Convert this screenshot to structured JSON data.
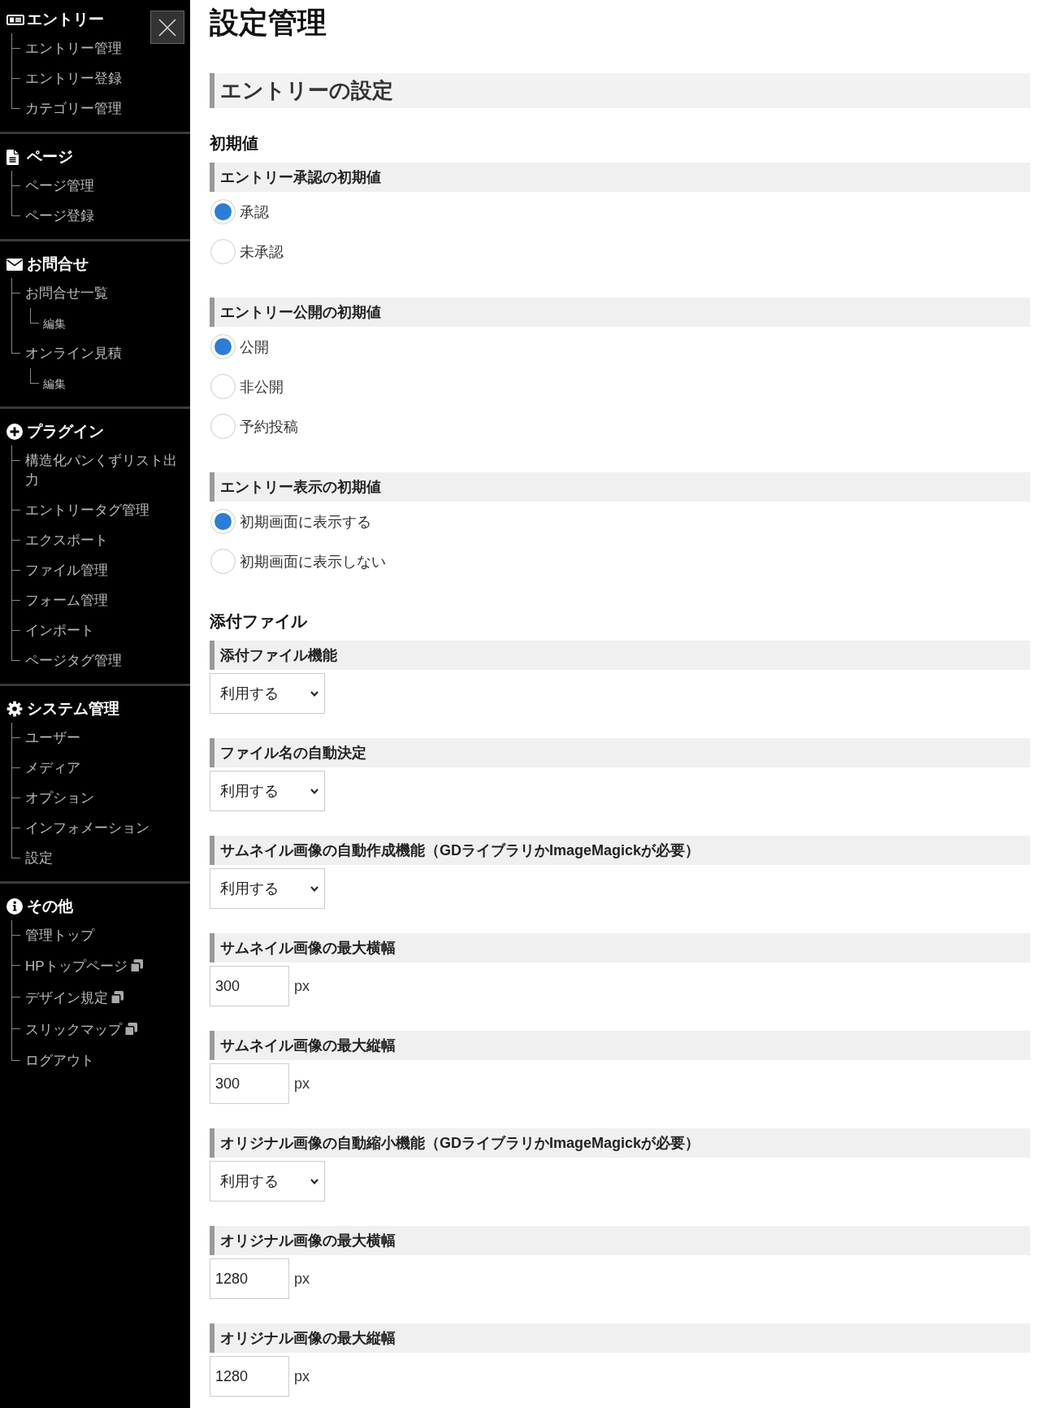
{
  "sidebar": {
    "sections": [
      {
        "title": "エントリー",
        "items": [
          {
            "label": "エントリー管理",
            "external": false
          },
          {
            "label": "エントリー登録",
            "external": false
          },
          {
            "label": "カテゴリー管理",
            "external": false
          }
        ]
      },
      {
        "title": "ページ",
        "items": [
          {
            "label": "ページ管理",
            "external": false
          },
          {
            "label": "ページ登録",
            "external": false
          }
        ]
      },
      {
        "title": "お問合せ",
        "items": [
          {
            "label": "お問合せ一覧",
            "external": false,
            "children": [
              {
                "label": "編集",
                "external": false
              }
            ]
          },
          {
            "label": "オンライン見積",
            "external": false,
            "children": [
              {
                "label": "編集",
                "external": false
              }
            ]
          }
        ]
      },
      {
        "title": "プラグイン",
        "items": [
          {
            "label": "構造化パンくずリスト出力",
            "external": false
          },
          {
            "label": "エントリータグ管理",
            "external": false
          },
          {
            "label": "エクスポート",
            "external": false
          },
          {
            "label": "ファイル管理",
            "external": false
          },
          {
            "label": "フォーム管理",
            "external": false
          },
          {
            "label": "インポート",
            "external": false
          },
          {
            "label": "ページタグ管理",
            "external": false
          }
        ]
      },
      {
        "title": "システム管理",
        "items": [
          {
            "label": "ユーザー",
            "external": false
          },
          {
            "label": "メディア",
            "external": false
          },
          {
            "label": "オプション",
            "external": false
          },
          {
            "label": "インフォメーション",
            "external": false
          },
          {
            "label": "設定",
            "external": false
          }
        ]
      },
      {
        "title": "その他",
        "items": [
          {
            "label": "管理トップ",
            "external": false
          },
          {
            "label": "HPトップページ",
            "external": true
          },
          {
            "label": "デザイン規定",
            "external": true
          },
          {
            "label": "スリックマップ",
            "external": true
          },
          {
            "label": "ログアウト",
            "external": false
          }
        ]
      }
    ]
  },
  "page_title": "設定管理",
  "panel": {
    "title": "エントリーの設定",
    "groups": [
      {
        "heading": "初期値",
        "fields": [
          {
            "label": "エントリー承認の初期値",
            "kind": "radio",
            "options": [
              {
                "label": "承認",
                "selected": true
              },
              {
                "label": "未承認",
                "selected": false
              }
            ]
          },
          {
            "label": "エントリー公開の初期値",
            "kind": "radio",
            "options": [
              {
                "label": "公開",
                "selected": true
              },
              {
                "label": "非公開",
                "selected": false
              },
              {
                "label": "予約投稿",
                "selected": false
              }
            ]
          },
          {
            "label": "エントリー表示の初期値",
            "kind": "radio",
            "options": [
              {
                "label": "初期画面に表示する",
                "selected": true
              },
              {
                "label": "初期画面に表示しない",
                "selected": false
              }
            ]
          }
        ]
      },
      {
        "heading": "添付ファイル",
        "fields": [
          {
            "label": "添付ファイル機能",
            "kind": "select",
            "value": "利用する"
          },
          {
            "label": "ファイル名の自動決定",
            "kind": "select",
            "value": "利用する"
          },
          {
            "label": "サムネイル画像の自動作成機能（GDライブラリかImageMagickが必要）",
            "kind": "select",
            "value": "利用する"
          },
          {
            "label": "サムネイル画像の最大横幅",
            "kind": "number",
            "value": "300",
            "unit": "px"
          },
          {
            "label": "サムネイル画像の最大縦幅",
            "kind": "number",
            "value": "300",
            "unit": "px"
          },
          {
            "label": "オリジナル画像の自動縮小機能（GDライブラリかImageMagickが必要）",
            "kind": "select",
            "value": "利用する"
          },
          {
            "label": "オリジナル画像の最大横幅",
            "kind": "number",
            "value": "1280",
            "unit": "px"
          },
          {
            "label": "オリジナル画像の最大縦幅",
            "kind": "number",
            "value": "1280",
            "unit": "px"
          }
        ]
      }
    ]
  }
}
